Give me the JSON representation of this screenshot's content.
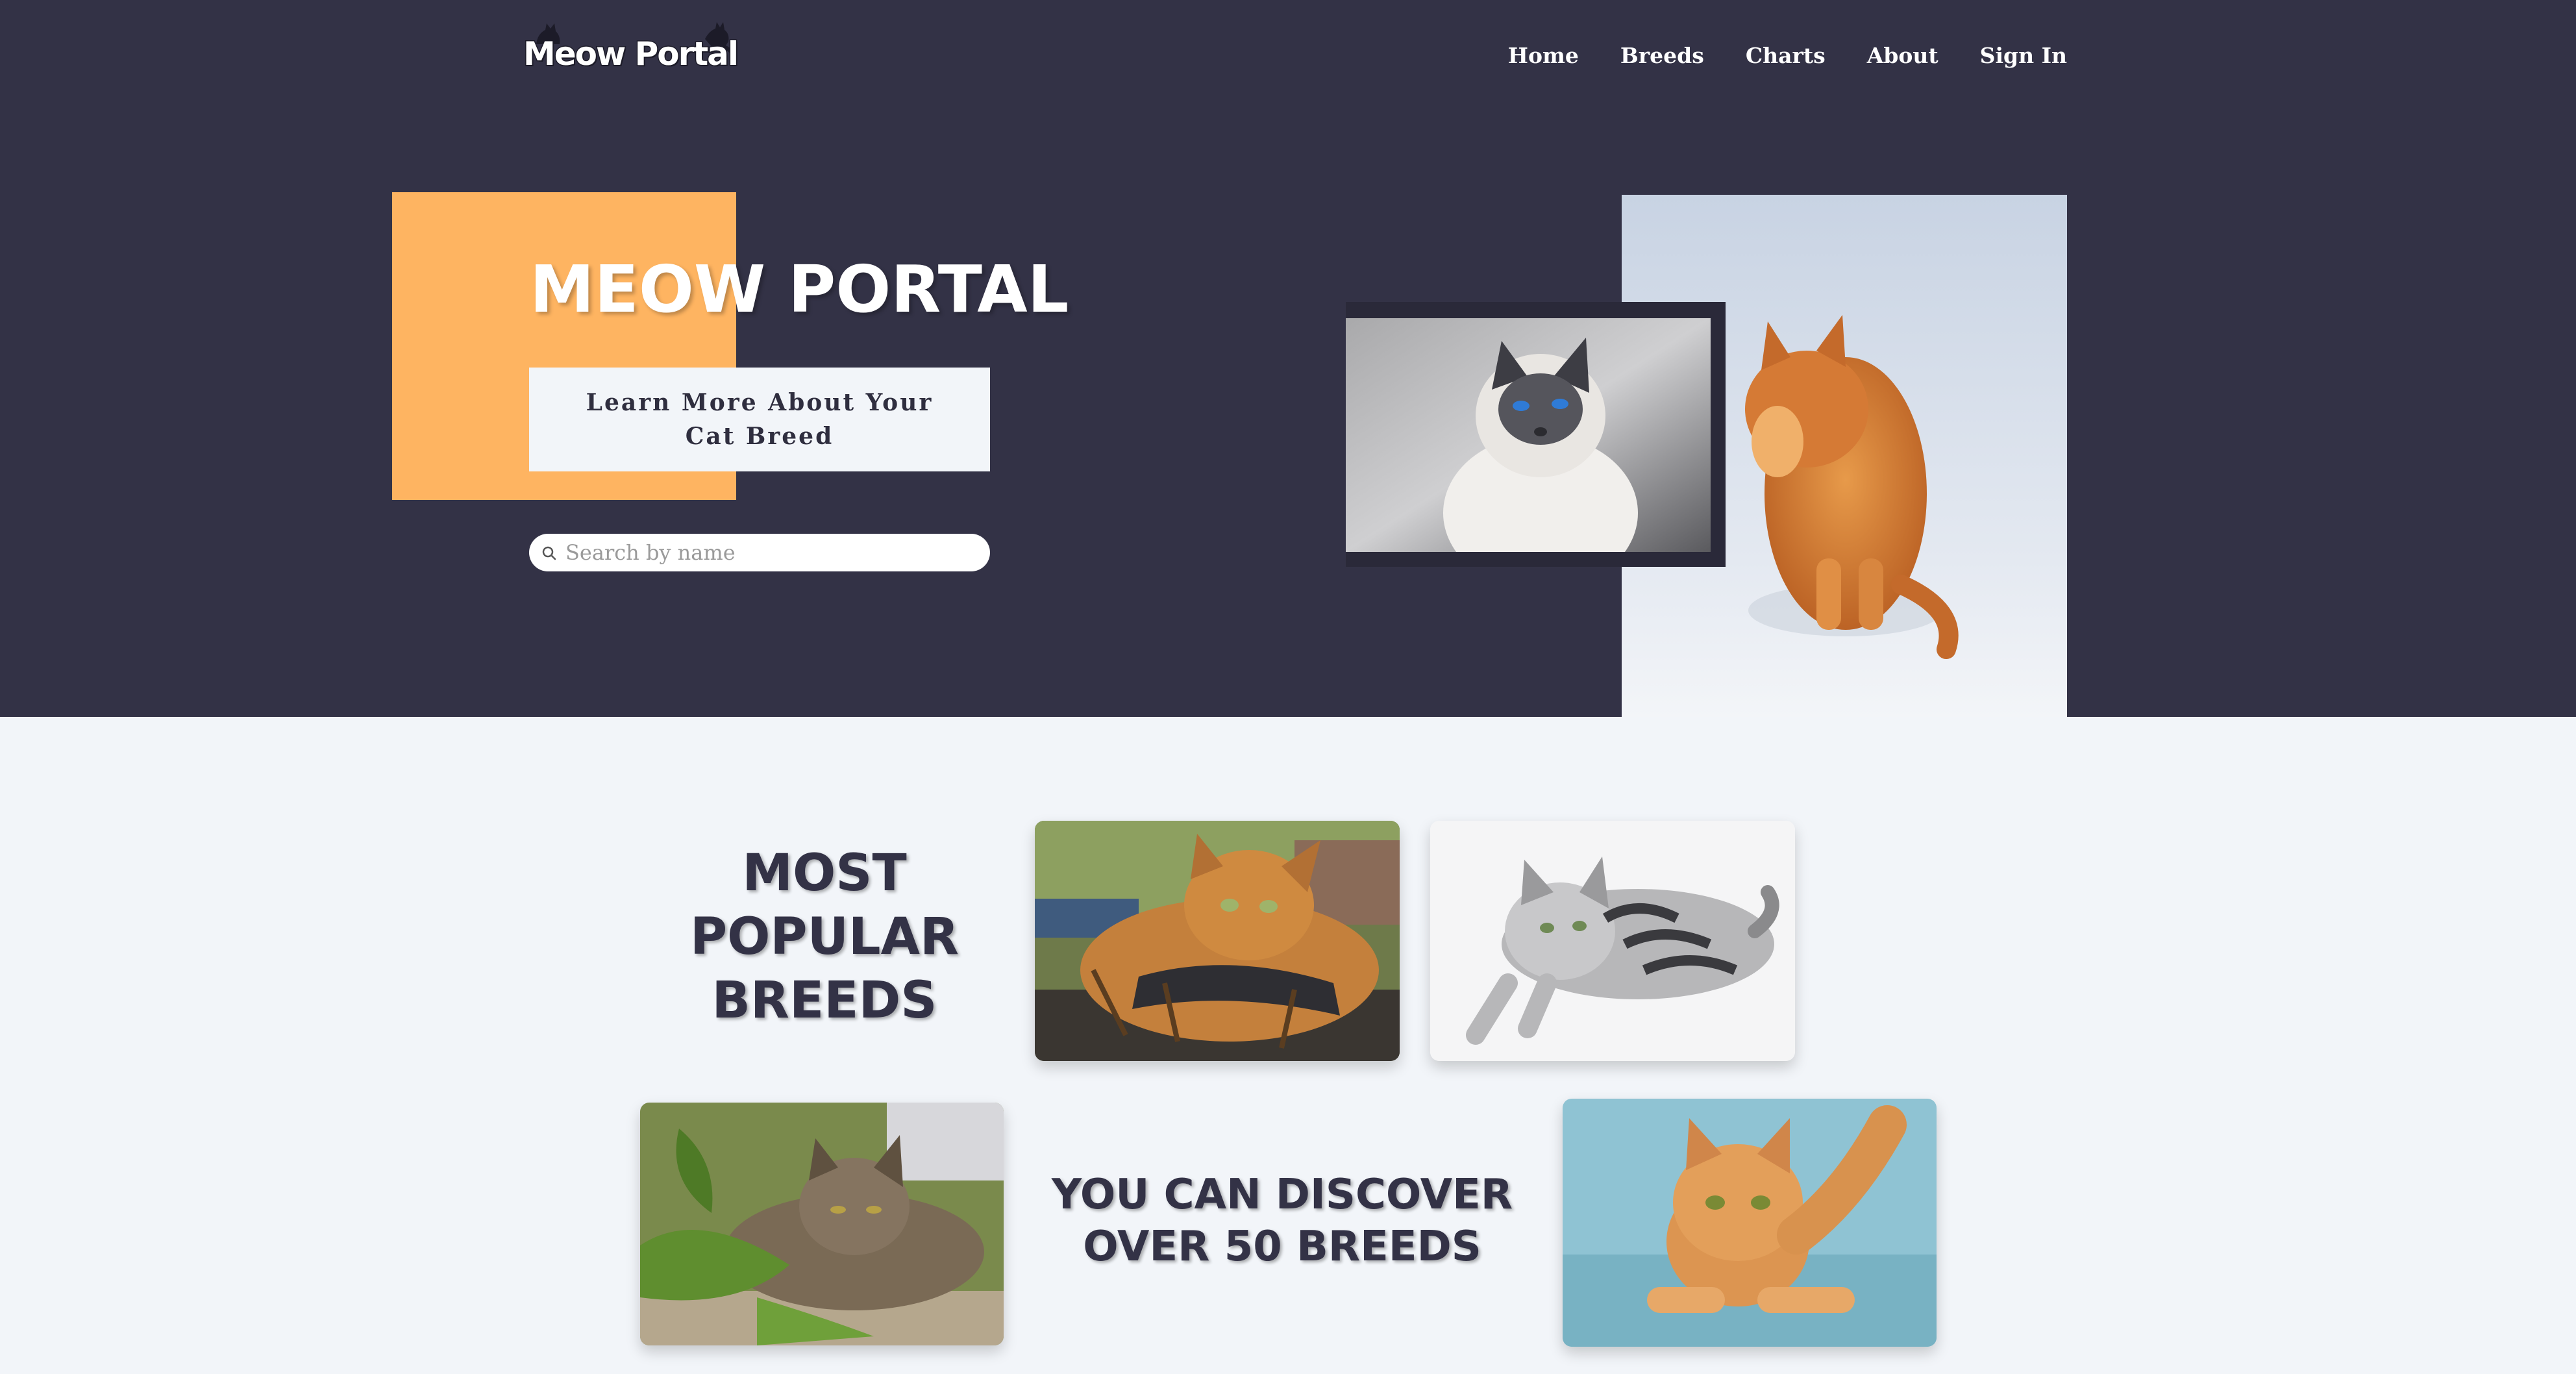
{
  "logo": {
    "text": "Meow Portal"
  },
  "nav": {
    "items": [
      {
        "label": "Home"
      },
      {
        "label": "Breeds"
      },
      {
        "label": "Charts"
      },
      {
        "label": "About"
      },
      {
        "label": "Sign In"
      }
    ]
  },
  "hero": {
    "title": "MEOW PORTAL",
    "cta_label": "Learn More About Your Cat Breed",
    "search_placeholder": "Search by name"
  },
  "popular": {
    "title": "MOST POPULAR BREEDS",
    "discover_text": "YOU CAN DISCOVER OVER 50 BREEDS"
  },
  "colors": {
    "hero_bg": "#333246",
    "accent_orange": "#feb461",
    "page_bg": "#f2f5f9",
    "heading_dark": "#333246"
  },
  "icons": {
    "search": "search-icon"
  }
}
